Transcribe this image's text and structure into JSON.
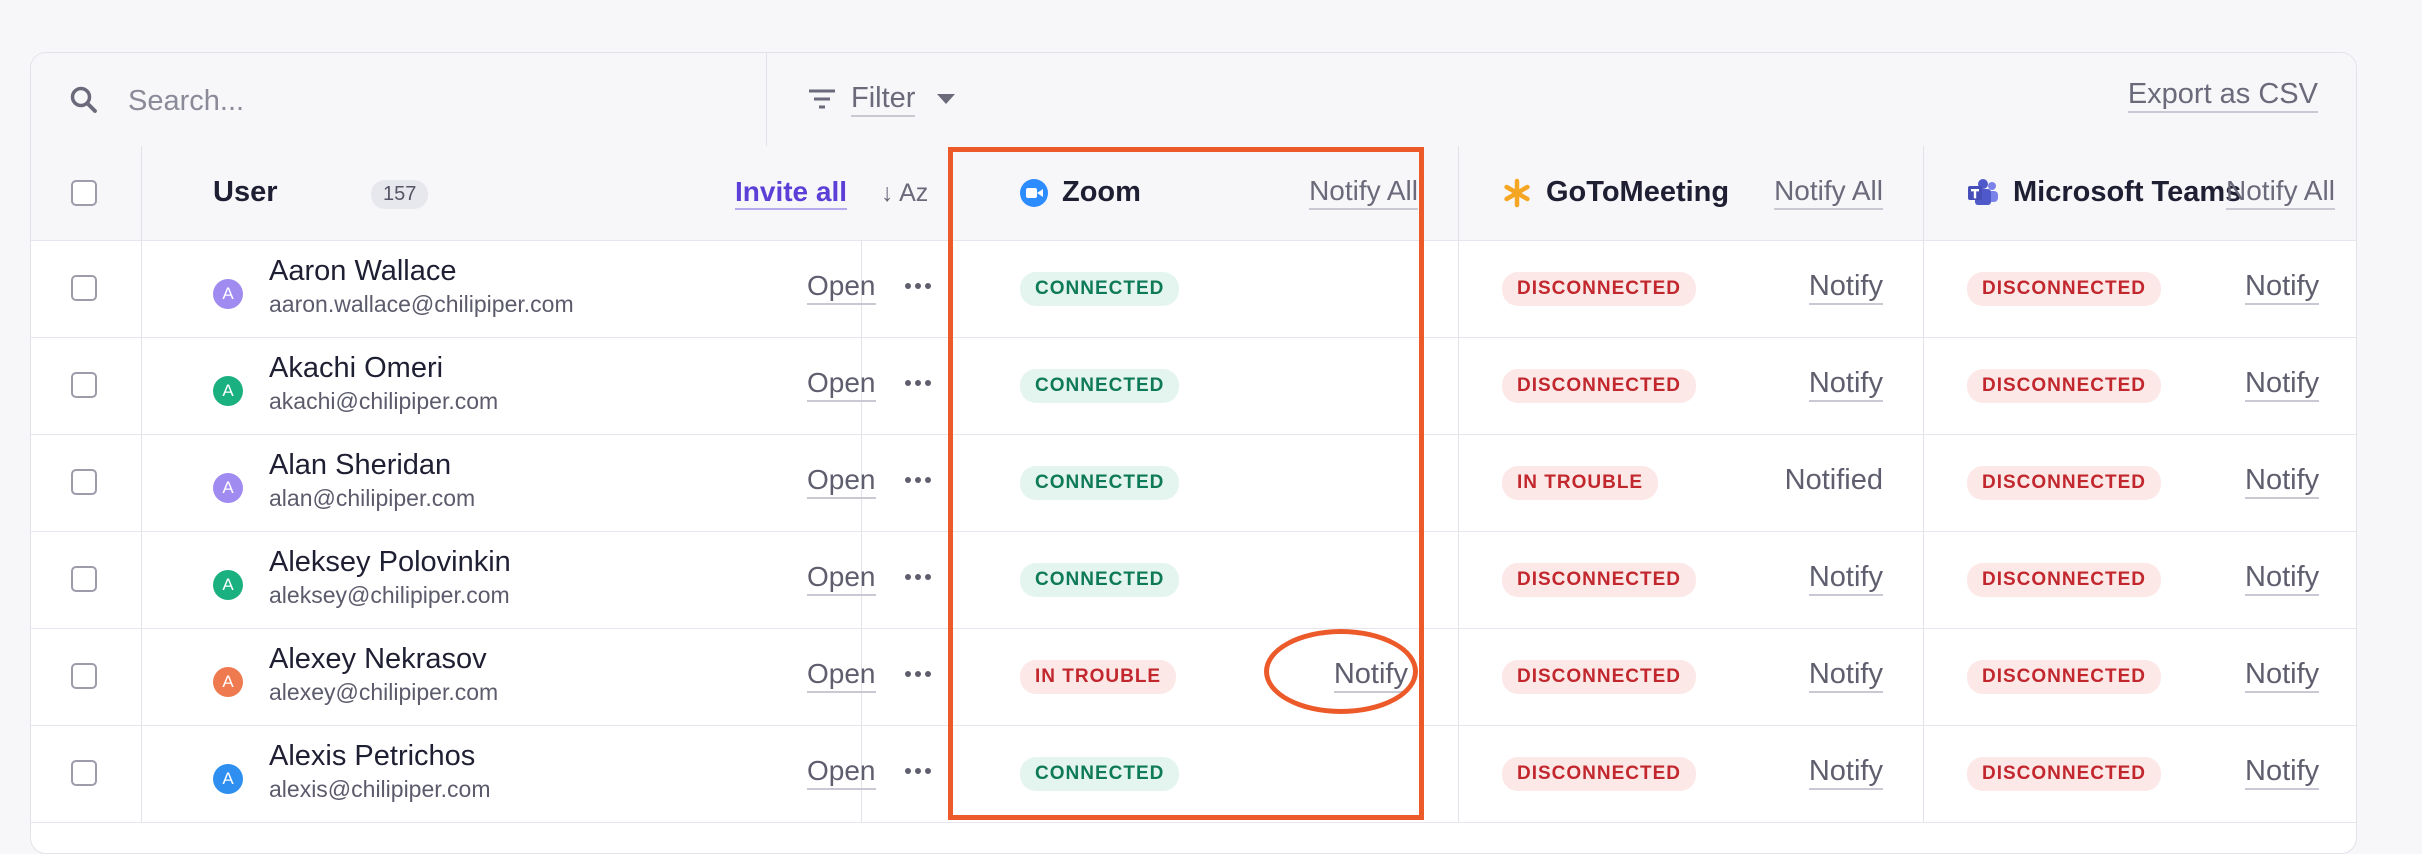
{
  "toolbar": {
    "search_placeholder": "Search...",
    "filter_label": "Filter",
    "export_label": "Export as CSV"
  },
  "header": {
    "user_label": "User",
    "user_count": "157",
    "invite_all": "Invite all",
    "sort_label": "↓ Az",
    "providers": [
      {
        "name": "Zoom",
        "notify_all": "Notify All"
      },
      {
        "name": "GoToMeeting",
        "notify_all": "Notify All"
      },
      {
        "name": "Microsoft Teams",
        "notify_all": "Notify All"
      }
    ]
  },
  "open_label": "Open",
  "rows": [
    {
      "initial": "A",
      "avatar_color": "#a08cf0",
      "name": "Aaron Wallace",
      "email": "aaron.wallace@chilipiper.com",
      "zoom": {
        "status": "CONNECTED",
        "action": ""
      },
      "goto": {
        "status": "DISCONNECTED",
        "action": "Notify"
      },
      "teams": {
        "status": "DISCONNECTED",
        "action": "Notify"
      }
    },
    {
      "initial": "A",
      "avatar_color": "#1bb07f",
      "name": "Akachi Omeri",
      "email": "akachi@chilipiper.com",
      "zoom": {
        "status": "CONNECTED",
        "action": ""
      },
      "goto": {
        "status": "DISCONNECTED",
        "action": "Notify"
      },
      "teams": {
        "status": "DISCONNECTED",
        "action": "Notify"
      }
    },
    {
      "initial": "A",
      "avatar_color": "#a08cf0",
      "name": "Alan Sheridan",
      "email": "alan@chilipiper.com",
      "zoom": {
        "status": "CONNECTED",
        "action": ""
      },
      "goto": {
        "status": "IN TROUBLE",
        "action": "Notified"
      },
      "teams": {
        "status": "DISCONNECTED",
        "action": "Notify"
      }
    },
    {
      "initial": "A",
      "avatar_color": "#1bb07f",
      "name": "Aleksey Polovinkin",
      "email": "aleksey@chilipiper.com",
      "zoom": {
        "status": "CONNECTED",
        "action": ""
      },
      "goto": {
        "status": "DISCONNECTED",
        "action": "Notify"
      },
      "teams": {
        "status": "DISCONNECTED",
        "action": "Notify"
      }
    },
    {
      "initial": "A",
      "avatar_color": "#ef7a4f",
      "name": "Alexey Nekrasov",
      "email": "alexey@chilipiper.com",
      "zoom": {
        "status": "IN TROUBLE",
        "action": "Notify"
      },
      "goto": {
        "status": "DISCONNECTED",
        "action": "Notify"
      },
      "teams": {
        "status": "DISCONNECTED",
        "action": "Notify"
      }
    },
    {
      "initial": "A",
      "avatar_color": "#2e8ff0",
      "name": "Alexis Petrichos",
      "email": "alexis@chilipiper.com",
      "zoom": {
        "status": "CONNECTED",
        "action": ""
      },
      "goto": {
        "status": "DISCONNECTED",
        "action": "Notify"
      },
      "teams": {
        "status": "DISCONNECTED",
        "action": "Notify"
      }
    }
  ],
  "colors": {
    "accent": "#5b3fd6",
    "connected_bg": "#e4f5ef",
    "connected_text": "#0f7a58",
    "trouble_bg": "#fde8e8",
    "trouble_text": "#c1272d",
    "annotation": "#ec5a2a"
  }
}
